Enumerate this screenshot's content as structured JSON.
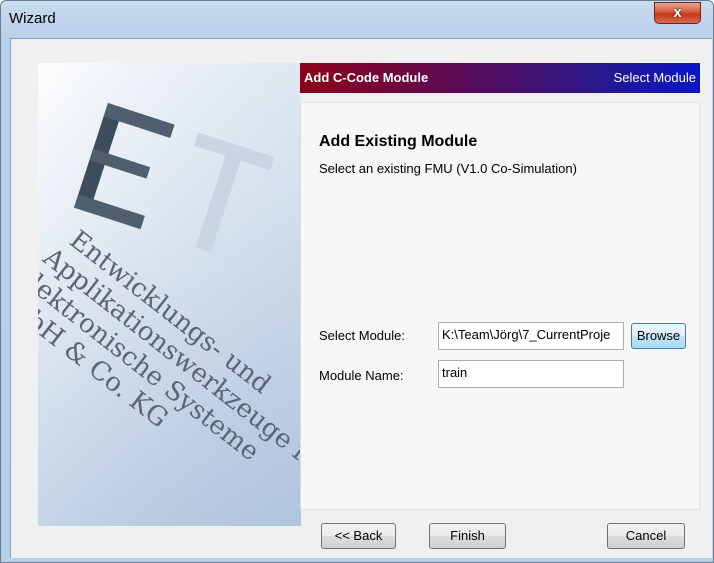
{
  "window": {
    "title": "Wizard",
    "close_glyph": "x"
  },
  "header": {
    "title": "Add C-Code Module",
    "step": "Select Module"
  },
  "content": {
    "heading": "Add Existing Module",
    "subtitle": "Select an existing FMU (V1.0 Co-Simulation)",
    "select_module_label": "Select Module:",
    "select_module_value": "K:\\Team\\Jörg\\7_CurrentProje",
    "browse_label": "Browse",
    "module_name_label": "Module Name:",
    "module_name_value": "train"
  },
  "banner": {
    "lines": [
      "Entwicklungs- und",
      "Applikationswerkzeuge für",
      "elektronische Systeme",
      "GmbH & Co. KG"
    ]
  },
  "buttons": {
    "back": "<< Back",
    "finish": "Finish",
    "cancel": "Cancel"
  }
}
